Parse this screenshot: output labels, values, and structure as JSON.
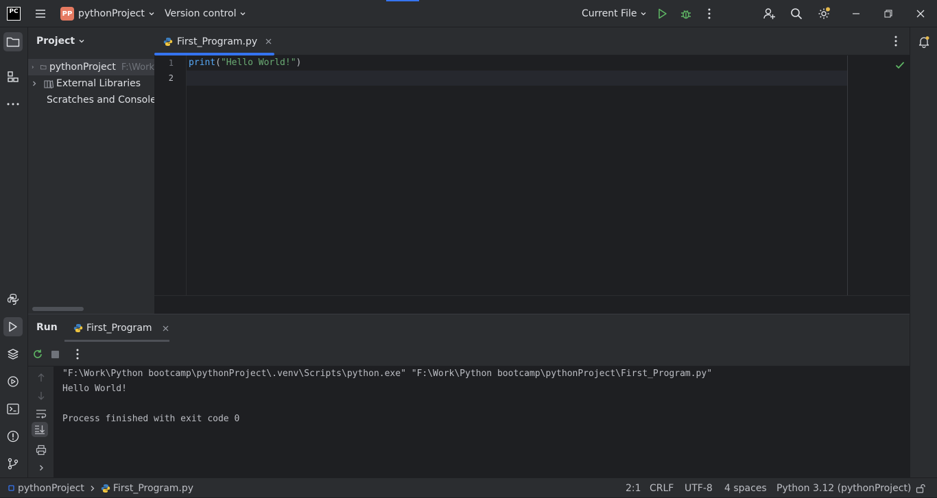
{
  "titlebar": {
    "logo": "PC",
    "project_badge": "PP",
    "project_name": "pythonProject",
    "vcs_label": "Version control",
    "run_config": "Current File"
  },
  "project_panel": {
    "title": "Project",
    "items": [
      {
        "label": "pythonProject",
        "path": "F:\\Work"
      },
      {
        "label": "External Libraries"
      },
      {
        "label": "Scratches and Consoles"
      }
    ]
  },
  "editor": {
    "tab_label": "First_Program.py",
    "lines": [
      {
        "num": "1",
        "code_fn": "print",
        "code_paren_open": "(",
        "code_str": "\"Hello World!\"",
        "code_paren_close": ")"
      },
      {
        "num": "2"
      }
    ]
  },
  "run_panel": {
    "title": "Run",
    "tab_label": "First_Program",
    "output": [
      "\"F:\\Work\\Python bootcamp\\pythonProject\\.venv\\Scripts\\python.exe\" \"F:\\Work\\Python bootcamp\\pythonProject\\First_Program.py\"",
      "Hello World!",
      "",
      "Process finished with exit code 0"
    ]
  },
  "statusbar": {
    "breadcrumb_project": "pythonProject",
    "breadcrumb_file": "First_Program.py",
    "position": "2:1",
    "line_sep": "CRLF",
    "encoding": "UTF-8",
    "indent": "4 spaces",
    "interpreter": "Python 3.12 (pythonProject)"
  },
  "colors": {
    "accent": "#3574f0",
    "string": "#6aab73",
    "function": "#56a8f5",
    "run_green": "#5fb865",
    "bg_dark": "#1e1f22",
    "bg_panel": "#2b2d30"
  }
}
